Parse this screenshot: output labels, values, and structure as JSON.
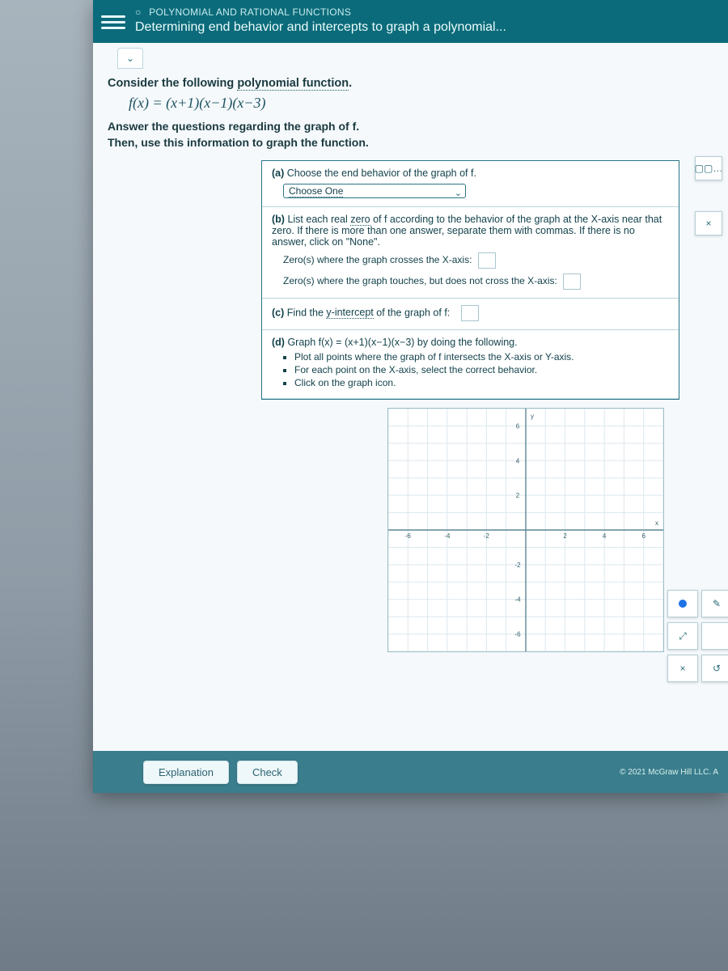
{
  "topbar": {
    "category": "POLYNOMIAL AND RATIONAL FUNCTIONS",
    "subtitle": "Determining end behavior and intercepts to graph a polynomial..."
  },
  "prompt": {
    "consider": "Consider the following ",
    "polyfn": "polynomial function",
    "period": ".",
    "fx": "f(x) = (x+1)(x−1)(x−3)",
    "answer1": "Answer the questions regarding the graph of f.",
    "answer2": "Then, use this information to graph the function."
  },
  "qa": {
    "a_label": "(a)",
    "a_text": " Choose the end behavior of the graph of f.",
    "choose_one": "Choose One",
    "b_label": "(b)",
    "b_text": " List each real ",
    "b_zero": "zero",
    "b_rest": " of f according to the behavior of the graph at the X-axis near that zero. If there is more than one answer, separate them with commas. If there is no answer, click on \"None\".",
    "b_cross": "Zero(s) where the graph crosses the X-axis:",
    "b_touch": "Zero(s) where the graph touches, but does not cross the X-axis:",
    "c_label": "(c)",
    "c_text_pre": " Find the ",
    "c_yint": "y-intercept",
    "c_text_post": " of the graph of f:",
    "d_label": "(d)",
    "d_text": " Graph f(x) = (x+1)(x−1)(x−3) by doing the following.",
    "d_b1": "Plot all points where the graph of f intersects the X-axis or Y-axis.",
    "d_b2": "For each point on the X-axis, select the correct behavior.",
    "d_b3": "Click on the graph icon."
  },
  "tools": {
    "calc": "▢▢…",
    "close": "×",
    "reset": "↺",
    "zoom": "⤢"
  },
  "footer": {
    "explanation": "Explanation",
    "check": "Check",
    "copyright": "© 2021 McGraw Hill LLC. A"
  },
  "chart_data": {
    "type": "scatter",
    "title": "",
    "xlabel": "x",
    "ylabel": "y",
    "xlim": [
      -7,
      7
    ],
    "ylim": [
      -7,
      7
    ],
    "x_ticks": [
      -6,
      -4,
      -2,
      2,
      4,
      6
    ],
    "y_ticks": [
      -6,
      -4,
      -2,
      2,
      4,
      6
    ],
    "series": []
  }
}
